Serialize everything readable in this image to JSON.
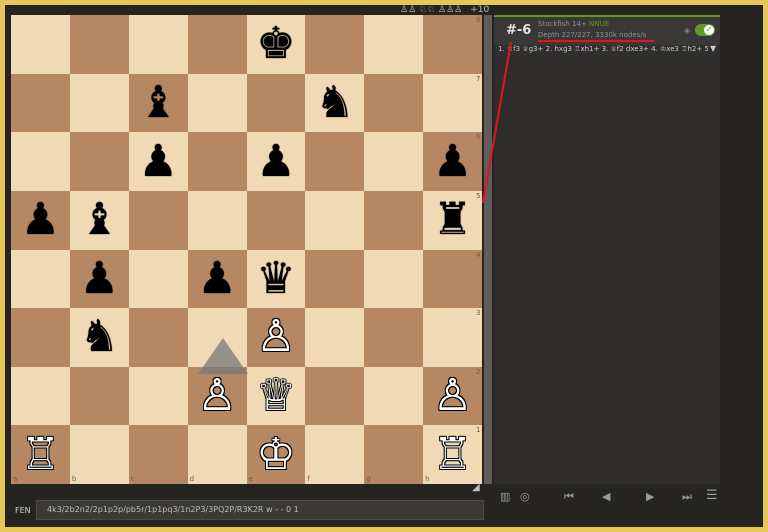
{
  "top_strip": {
    "captured": "♙♙ ♘♘ ♙♙♙",
    "advantage": "+10"
  },
  "board": {
    "files": [
      "a",
      "b",
      "c",
      "d",
      "e",
      "f",
      "g",
      "h"
    ],
    "ranks": [
      "8",
      "7",
      "6",
      "5",
      "4",
      "3",
      "2",
      "1"
    ],
    "pieces": [
      {
        "square": "e8",
        "glyph": "♚",
        "color": "black",
        "name": "black-king"
      },
      {
        "square": "c7",
        "glyph": "♝",
        "color": "black",
        "name": "black-bishop"
      },
      {
        "square": "f7",
        "glyph": "♞",
        "color": "black",
        "name": "black-knight"
      },
      {
        "square": "c6",
        "glyph": "♟",
        "color": "black",
        "name": "black-pawn"
      },
      {
        "square": "e6",
        "glyph": "♟",
        "color": "black",
        "name": "black-pawn"
      },
      {
        "square": "h6",
        "glyph": "♟",
        "color": "black",
        "name": "black-pawn"
      },
      {
        "square": "a5",
        "glyph": "♟",
        "color": "black",
        "name": "black-pawn"
      },
      {
        "square": "b5",
        "glyph": "♝",
        "color": "black",
        "name": "black-bishop"
      },
      {
        "square": "h5",
        "glyph": "♜",
        "color": "black",
        "name": "black-rook"
      },
      {
        "square": "b4",
        "glyph": "♟",
        "color": "black",
        "name": "black-pawn"
      },
      {
        "square": "d4",
        "glyph": "♟",
        "color": "black",
        "name": "black-pawn"
      },
      {
        "square": "e4",
        "glyph": "♛",
        "color": "black",
        "name": "black-queen"
      },
      {
        "square": "b3",
        "glyph": "♞",
        "color": "black",
        "name": "black-knight"
      },
      {
        "square": "e3",
        "glyph": "♙",
        "color": "white",
        "name": "white-pawn"
      },
      {
        "square": "d2",
        "glyph": "♙",
        "color": "white",
        "name": "white-pawn"
      },
      {
        "square": "e2",
        "glyph": "♕",
        "color": "white",
        "name": "white-queen"
      },
      {
        "square": "h2",
        "glyph": "♙",
        "color": "white",
        "name": "white-pawn"
      },
      {
        "square": "a1",
        "glyph": "♖",
        "color": "white",
        "name": "white-rook"
      },
      {
        "square": "e1",
        "glyph": "♔",
        "color": "white",
        "name": "white-king"
      },
      {
        "square": "h1",
        "glyph": "♖",
        "color": "white",
        "name": "white-rook"
      }
    ]
  },
  "engine": {
    "eval": "#-6",
    "name": "Stockfish 14+",
    "nnue": "NNUE",
    "depth": "Depth 227/227, 3330k nodes/s",
    "pv": "1. ♕f3 ♕g3+ 2. hxg3 ♖xh1+ 3. ♕f2 dxe3+ 4. ♔xe3 ♖h2+ 5. ♔f1…",
    "enabled": true
  },
  "controls": {
    "book_icon": "book-icon",
    "settings_icon": "target-icon",
    "first": "⏮",
    "prev": "◀",
    "next": "▶",
    "last": "⏭",
    "menu": "☰"
  },
  "fen": {
    "label": "FEN",
    "value": "4k3/2b2n2/2p1p2p/pb5r/1p1pq3/1n2P3/3PQ2P/R3K2R w - - 0 1"
  }
}
